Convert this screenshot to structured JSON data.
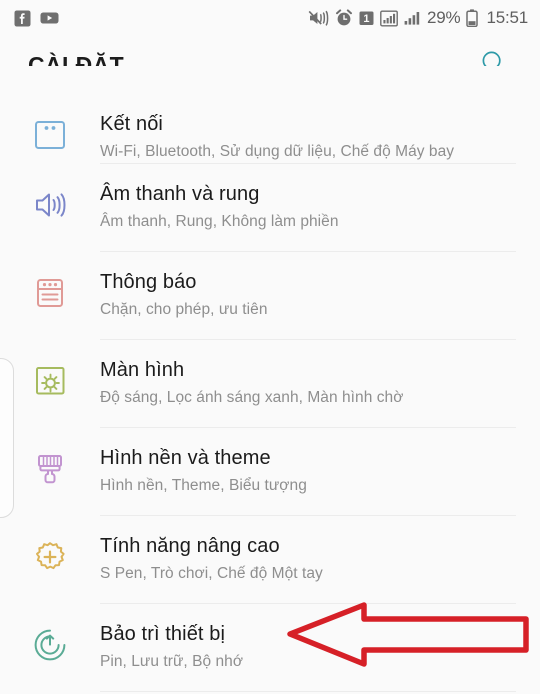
{
  "statusbar": {
    "left_icons": [
      {
        "name": "facebook-icon",
        "glyph": "f"
      },
      {
        "name": "youtube-icon",
        "glyph": "▶"
      }
    ],
    "mute_icon": "sound-mute-vibrate-icon",
    "alarm_icon": "alarm-clock-icon",
    "sim_icon": "sim-card-1-icon",
    "sim_label": "1",
    "signal_icon_1": "signal-bars-boxed-icon",
    "signal_icon_2": "signal-bars-icon",
    "battery_percent": "29%",
    "battery_icon": "battery-icon",
    "clock": "15:51"
  },
  "header": {
    "title": "CÀI ĐẶT",
    "search_icon": "search-icon",
    "search_color": "#2e9aa8"
  },
  "settings": {
    "rows": [
      {
        "icon": "connections-icon",
        "icon_color": "#7bb0d8",
        "title": "Kết nối",
        "subtitle": "Wi-Fi, Bluetooth, Sử dụng dữ liệu, Chế độ Máy bay"
      },
      {
        "icon": "sound-vibration-icon",
        "icon_color": "#7b86c9",
        "title": "Âm thanh và rung",
        "subtitle": "Âm thanh, Rung, Không làm phiền"
      },
      {
        "icon": "notifications-icon",
        "icon_color": "#e09a96",
        "title": "Thông báo",
        "subtitle": "Chặn, cho phép, ưu tiên"
      },
      {
        "icon": "display-icon",
        "icon_color": "#a6bb5e",
        "title": "Màn hình",
        "subtitle": "Độ sáng, Lọc ánh sáng xanh, Màn hình chờ"
      },
      {
        "icon": "wallpaper-theme-icon",
        "icon_color": "#c294d0",
        "title": "Hình nền và theme",
        "subtitle": "Hình nền, Theme, Biểu tượng"
      },
      {
        "icon": "advanced-features-icon",
        "icon_color": "#dbb358",
        "title": "Tính năng nâng cao",
        "subtitle": "S Pen, Trò chơi, Chế độ Một tay"
      },
      {
        "icon": "device-maintenance-icon",
        "icon_color": "#5aab95",
        "title": "Bảo trì thiết bị",
        "subtitle": "Pin, Lưu trữ, Bộ nhớ"
      }
    ]
  },
  "annotation": {
    "arrow_name": "red-left-arrow-annotation",
    "arrow_color": "#d62027",
    "points_to": "Bảo trì thiết bị"
  },
  "edge_panel": {
    "handle_name": "edge-panel-handle"
  }
}
